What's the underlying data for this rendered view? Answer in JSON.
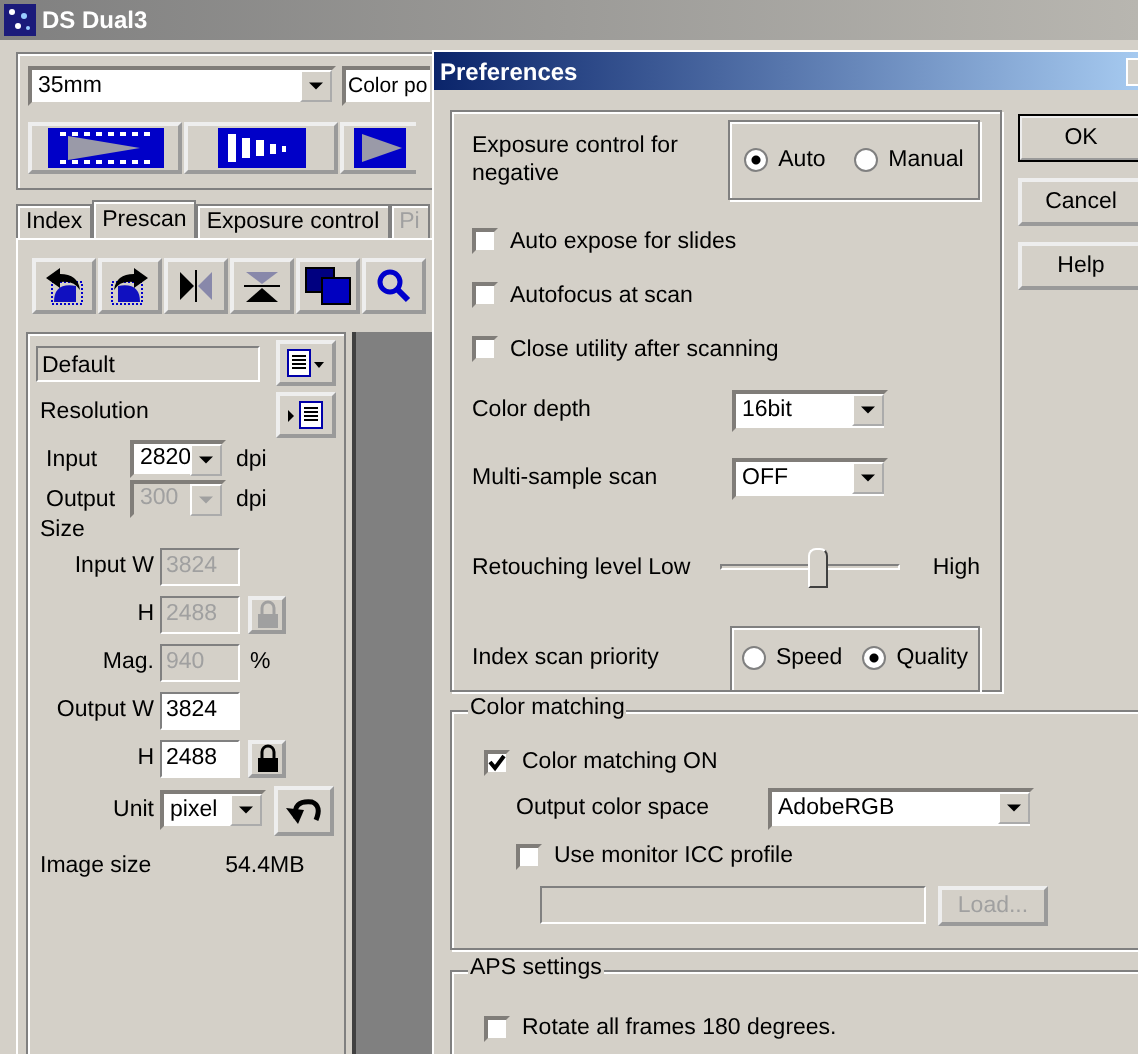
{
  "main_window": {
    "title": "DS Dual3",
    "film_type": {
      "value": "35mm"
    },
    "color_mode": {
      "value": "Color po"
    },
    "tabs": [
      {
        "label": "Index",
        "selected": false,
        "disabled": false
      },
      {
        "label": "Prescan",
        "selected": true,
        "disabled": false
      },
      {
        "label": "Exposure control",
        "selected": false,
        "disabled": false
      },
      {
        "label": "Pi",
        "selected": false,
        "disabled": true
      }
    ],
    "settings_name": "Default",
    "resolution": {
      "label": "Resolution",
      "rows": [
        {
          "label": "Input",
          "value": "2820",
          "unit": "dpi",
          "disabled": false
        },
        {
          "label": "Output",
          "value": "300",
          "unit": "dpi",
          "disabled": true
        }
      ]
    },
    "size": {
      "label": "Size",
      "rows": [
        {
          "label": "Input W",
          "value": "3824",
          "disabled": true
        },
        {
          "label": "H",
          "value": "2488",
          "disabled": true,
          "lock": true
        },
        {
          "label": "Mag.",
          "value": "940",
          "unit": "%",
          "disabled": true
        },
        {
          "label": "Output W",
          "value": "3824",
          "disabled": false
        },
        {
          "label": "H",
          "value": "2488",
          "disabled": false,
          "lock": true
        }
      ]
    },
    "unit": {
      "label": "Unit",
      "value": "pixel"
    },
    "image_size": {
      "label": "Image size",
      "value": "54.4MB"
    }
  },
  "preferences": {
    "title": "Preferences",
    "exposure": {
      "label": "Exposure control for negative",
      "options": [
        {
          "label": "Auto",
          "selected": true
        },
        {
          "label": "Manual",
          "selected": false
        }
      ]
    },
    "checkboxes": [
      {
        "label": "Auto expose for slides",
        "checked": false
      },
      {
        "label": "Autofocus at scan",
        "checked": false
      },
      {
        "label": "Close utility after scanning",
        "checked": false
      }
    ],
    "color_depth": {
      "label": "Color depth",
      "value": "16bit"
    },
    "multi_sample": {
      "label": "Multi-sample scan",
      "value": "OFF"
    },
    "retouching": {
      "label": "Retouching level",
      "low": "Low",
      "high": "High",
      "level": 0.5
    },
    "index_priority": {
      "label": "Index scan priority",
      "options": [
        {
          "label": "Speed",
          "selected": false
        },
        {
          "label": "Quality",
          "selected": true
        }
      ]
    },
    "color_matching": {
      "title": "Color matching",
      "enabled": {
        "label": "Color matching ON",
        "checked": true
      },
      "output_space": {
        "label": "Output color space",
        "value": "AdobeRGB"
      },
      "monitor_icc": {
        "label": "Use monitor ICC profile",
        "checked": false
      },
      "load_button": {
        "label": "Load...",
        "disabled": true
      }
    },
    "aps": {
      "title": "APS settings",
      "rotate": {
        "label": "Rotate all frames 180 degrees.",
        "checked": false
      }
    },
    "buttons": [
      {
        "label": "OK",
        "default": true
      },
      {
        "label": "Cancel",
        "default": false
      },
      {
        "label": "Help",
        "default": false
      }
    ]
  }
}
